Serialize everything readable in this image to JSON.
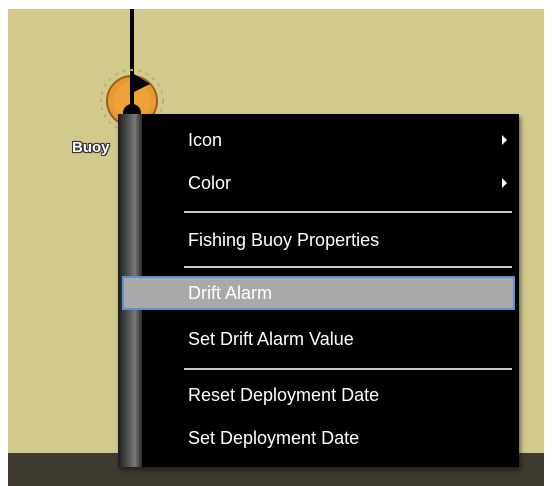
{
  "map": {
    "buoy_label": "Buoy"
  },
  "context_menu": {
    "items": [
      {
        "label": "Icon",
        "has_submenu": true
      },
      {
        "label": "Color",
        "has_submenu": true
      },
      {
        "label": "Fishing Buoy Properties"
      },
      {
        "label": "Drift Alarm",
        "highlighted": true
      },
      {
        "label": "Set Drift Alarm Value"
      },
      {
        "label": "Reset Deployment Date"
      },
      {
        "label": "Set Deployment Date"
      }
    ]
  },
  "colors": {
    "map_background": "#d2c98c",
    "menu_background": "#000000",
    "highlight_background": "#a9a9a9",
    "highlight_border": "#5b8fd6",
    "buoy_orange": "#e89a32"
  },
  "icons": [
    "buoy-icon",
    "flag-icon",
    "submenu-arrow-icon"
  ]
}
